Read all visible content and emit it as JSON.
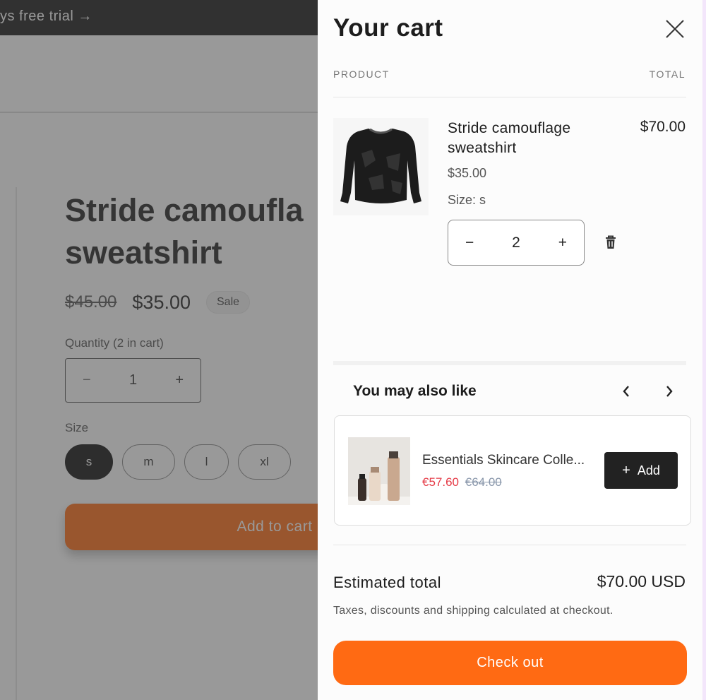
{
  "background_page": {
    "announcement": "ys free trial →",
    "product_title": "Stride camoufla\nsweatshirt",
    "old_price": "$45.00",
    "price": "$35.00",
    "sale_badge": "Sale",
    "quantity_label": "Quantity (2 in cart)",
    "quantity": {
      "minus": "−",
      "value": "1",
      "plus": "+"
    },
    "size_label": "Size",
    "sizes": [
      {
        "label": "s",
        "selected": true
      },
      {
        "label": "m",
        "selected": false
      },
      {
        "label": "l",
        "selected": false
      },
      {
        "label": "xl",
        "selected": false
      }
    ],
    "add_to_cart": "Add to cart"
  },
  "cart": {
    "title": "Your cart",
    "close_icon": "close-icon",
    "columns": {
      "product": "PRODUCT",
      "total": "TOTAL"
    },
    "items": [
      {
        "name": "Stride camouflage sweatshirt",
        "price": "$35.00",
        "size": "Size: s",
        "quantity": "2",
        "minus": "−",
        "plus": "+",
        "line_total": "$70.00",
        "remove_icon": "trash-icon"
      }
    ],
    "recommendations": {
      "title": "You may also like",
      "prev_icon": "chevron-left-icon",
      "next_icon": "chevron-right-icon",
      "products": [
        {
          "name": "Essentials Skincare Colle...",
          "sale_price": "€57.60",
          "compare_price": "€64.00",
          "add_label": "Add",
          "add_icon": "plus-icon"
        }
      ]
    },
    "estimated_total_label": "Estimated total",
    "estimated_total_value": "$70.00 USD",
    "tax_note": "Taxes, discounts and shipping calculated at checkout.",
    "checkout_label": "Check out"
  },
  "colors": {
    "accent": "#ff6a13",
    "dark": "#1a1a1a",
    "sale": "#e53945"
  }
}
